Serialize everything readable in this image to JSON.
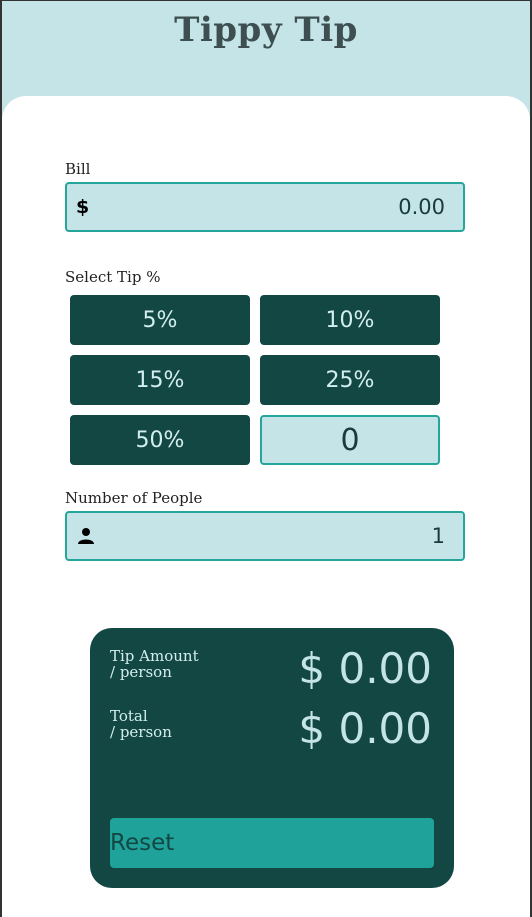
{
  "app": {
    "title": "Tippy Tip"
  },
  "bill": {
    "label": "Bill",
    "currency_icon": "$",
    "value": "0.00"
  },
  "tip": {
    "label": "Select Tip %",
    "options": [
      "5%",
      "10%",
      "15%",
      "25%",
      "50%"
    ],
    "custom_value": "0"
  },
  "people": {
    "label": "Number of People",
    "value": "1"
  },
  "results": {
    "tip_label_line1": "Tip Amount",
    "tip_label_line2": "/ person",
    "tip_value": "$ 0.00",
    "total_label_line1": "Total",
    "total_label_line2": "/ person",
    "total_value": "$ 0.00",
    "reset_label": "Reset"
  },
  "colors": {
    "background": "#c5e4e7",
    "dark_cyan": "#134744",
    "accent": "#26a69a"
  }
}
